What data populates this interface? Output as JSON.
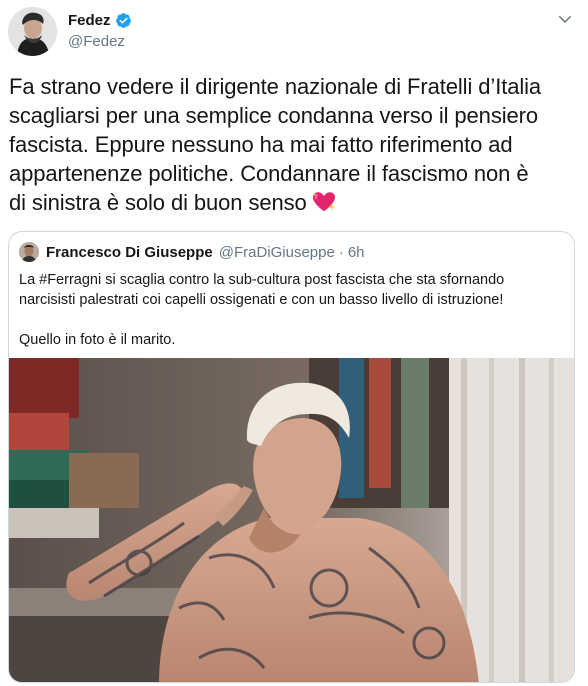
{
  "author": {
    "display_name": "Fedez",
    "handle": "@Fedez",
    "verified": true
  },
  "tweet": {
    "text_lines": [
      "Fa strano vedere il dirigente nazionale di Fratelli d’Italia",
      "scagliarsi per una semplice condanna verso il pensiero",
      "fascista. Eppure nessuno ha mai fatto riferimento ad",
      "appartenenze politiche. Condannare il fascismo non è",
      "di sinistra è solo di buon senso"
    ],
    "emoji": "sparkling-heart-icon"
  },
  "quote": {
    "display_name": "Francesco Di Giuseppe",
    "handle": "@FraDiGiuseppe",
    "time": "6h",
    "separator": "·",
    "text_line_1": "La #Ferragni si scaglia contro la sub-cultura post fascista che sta sfornando",
    "text_line_2": "narcisisti palestrati coi capelli ossigenati e con un basso livello di istruzione!",
    "text_line_3": "Quello in foto è il marito."
  },
  "colors": {
    "verified_blue": "#1da1f2",
    "secondary_text": "#657786",
    "border": "#ccd6dd"
  }
}
